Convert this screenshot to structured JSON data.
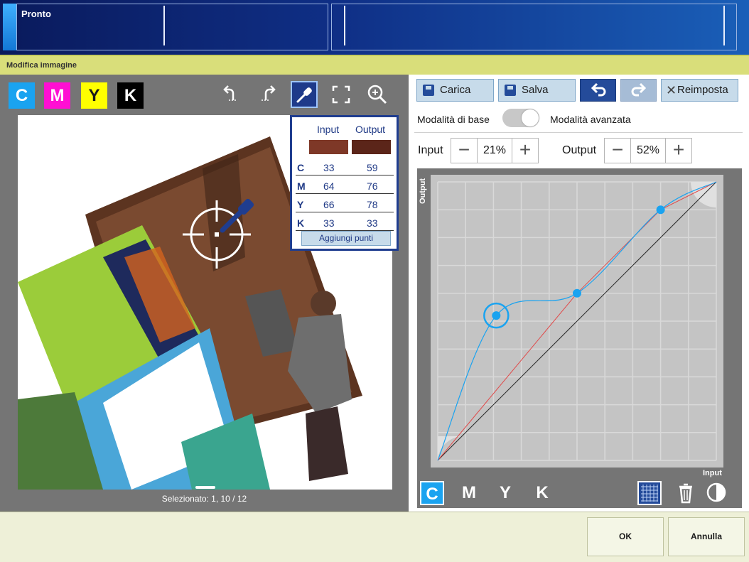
{
  "status": {
    "text": "Pronto"
  },
  "window": {
    "title": "Modifica immagine"
  },
  "left": {
    "channels": [
      {
        "label": "C",
        "bg": "#1aa3f0",
        "fg": "#ffffff"
      },
      {
        "label": "M",
        "bg": "#ff0fd3",
        "fg": "#ffffff"
      },
      {
        "label": "Y",
        "bg": "#ffff00",
        "fg": "#1a1a1a"
      },
      {
        "label": "K",
        "bg": "#000000",
        "fg": "#ffffff"
      }
    ],
    "selected_text": "Selezionato: 1, 10 / 12",
    "picker": {
      "input_header": "Input",
      "output_header": "Output",
      "input_color": "#7e3827",
      "output_color": "#5b2519",
      "rows": [
        {
          "label": "C",
          "input": "33",
          "output": "59"
        },
        {
          "label": "M",
          "input": "64",
          "output": "76"
        },
        {
          "label": "Y",
          "input": "66",
          "output": "78"
        },
        {
          "label": "K",
          "input": "33",
          "output": "33"
        }
      ],
      "add_points": "Aggiungi punti"
    }
  },
  "right": {
    "load_label": "Carica",
    "save_label": "Salva",
    "reset_label": "Reimposta",
    "mode_basic": "Modalità di base",
    "mode_advanced": "Modalità avanzata",
    "input_label": "Input",
    "input_value": "21%",
    "output_label": "Output",
    "output_value": "52%",
    "axis_x": "Input",
    "axis_y": "Output",
    "channels": [
      "C",
      "M",
      "Y",
      "K"
    ]
  },
  "actions": {
    "ok": "OK",
    "cancel": "Annulla"
  },
  "colors": {
    "accent": "#1f3d8f",
    "curve_cyan": "#1aa3f0",
    "curve_red": "#e04a4a"
  },
  "chart_data": {
    "type": "line",
    "xlabel": "Input",
    "ylabel": "Output",
    "xlim": [
      0,
      100
    ],
    "ylim": [
      0,
      100
    ],
    "control_points": [
      [
        0,
        0
      ],
      [
        21,
        52
      ],
      [
        50,
        60
      ],
      [
        80,
        90
      ],
      [
        100,
        100
      ]
    ],
    "selected_point": [
      21,
      52
    ]
  }
}
